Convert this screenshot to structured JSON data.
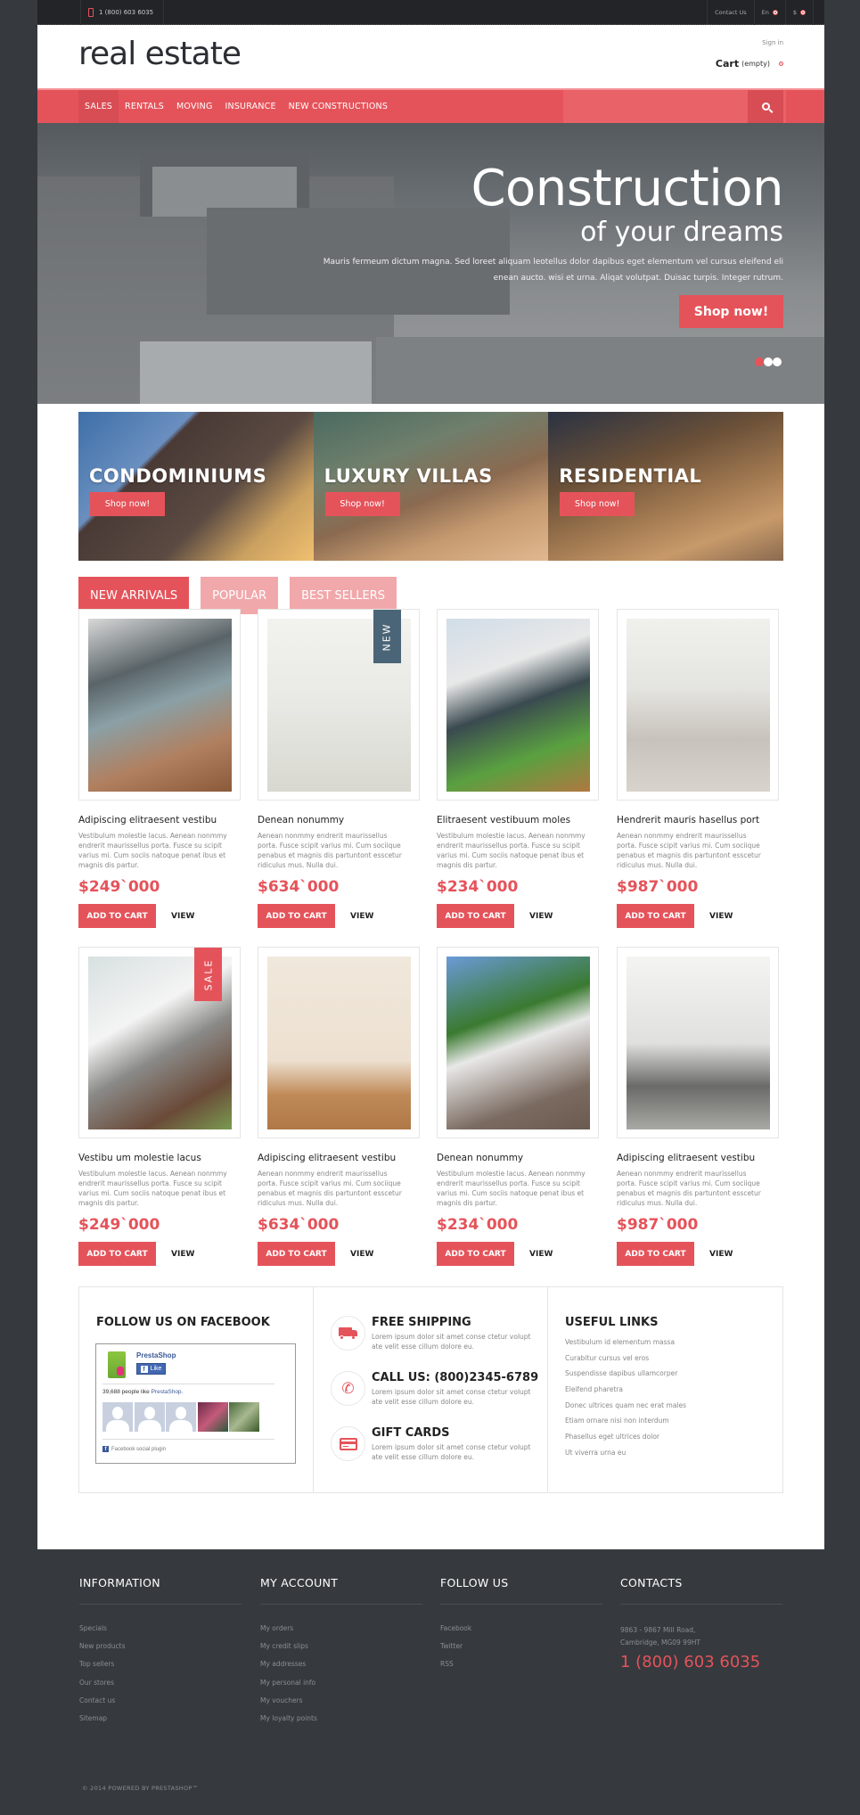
{
  "topbar": {
    "phone": "1 (800) 603 6035",
    "contact_us": "Contact Us",
    "language": "En",
    "currency": "$"
  },
  "header": {
    "logo": "real estate",
    "sign_in": "Sign in",
    "cart_label": "Cart",
    "cart_status": "(empty)"
  },
  "nav": {
    "items": [
      {
        "label": "SALES",
        "active": true
      },
      {
        "label": "RENTALS"
      },
      {
        "label": "MOVING"
      },
      {
        "label": "INSURANCE"
      },
      {
        "label": "NEW CONSTRUCTIONS"
      }
    ]
  },
  "hero": {
    "title": "Construction",
    "subtitle": "of your dreams",
    "text": "Mauris fermeum dictum magna. Sed loreet aliquam leotellus dolor dapibus eget elementum vel cursus eleifend eli enean aucto. wisi et urna. Aliqat volutpat. Duisac turpis. Integer rutrum.",
    "button": "Shop now!",
    "slides": 3,
    "active_slide": 1
  },
  "banners": [
    {
      "title": "CONDOMINIUMS",
      "button": "Shop now!"
    },
    {
      "title": "LUXURY VILLAS",
      "button": "Shop now!"
    },
    {
      "title": "RESIDENTIAL",
      "button": "Shop now!"
    }
  ],
  "tabs": [
    {
      "label": "NEW ARRIVALS",
      "active": true
    },
    {
      "label": "POPULAR"
    },
    {
      "label": "BEST SELLERS"
    }
  ],
  "products": [
    {
      "name": "Adipiscing elitraesent vestibu",
      "desc": "Vestibulum molestie lacus. Aenean nonmmy endrerit maurissellus porta. Fusce su scipit varius mi. Cum sociis natoque penat ibus et magnis dis partur.",
      "price": "$249`000",
      "add": "ADD TO CART",
      "view": "VIEW",
      "flag": ""
    },
    {
      "name": "Denean nonummy",
      "desc": "Aenean nonmmy endrerit maurissellus porta. Fusce scipit varius mi. Cum sociique penabus et magnis dis partuntont esscetur ridiculus mus. Nulla dui.",
      "price": "$634`000",
      "add": "ADD TO CART",
      "view": "VIEW",
      "flag": "NEW"
    },
    {
      "name": "Elitraesent vestibuum moles",
      "desc": "Vestibulum molestie lacus. Aenean nonmmy endrerit maurissellus porta. Fusce su scipit varius mi. Cum sociis natoque penat ibus et magnis dis partur.",
      "price": "$234`000",
      "add": "ADD TO CART",
      "view": "VIEW",
      "flag": ""
    },
    {
      "name": "Hendrerit mauris hasellus port",
      "desc": "Aenean nonmmy endrerit maurissellus porta. Fusce scipit varius mi. Cum sociique penabus et magnis dis partuntont esscetur ridiculus mus. Nulla dui.",
      "price": "$987`000",
      "add": "ADD TO CART",
      "view": "VIEW",
      "flag": ""
    },
    {
      "name": "Vestibu um molestie lacus",
      "desc": "Vestibulum molestie lacus. Aenean nonmmy endrerit maurissellus porta. Fusce su scipit varius mi. Cum sociis natoque penat ibus et magnis dis partur.",
      "price": "$249`000",
      "add": "ADD TO CART",
      "view": "VIEW",
      "flag": "SALE"
    },
    {
      "name": "Adipiscing elitraesent vestibu",
      "desc": "Aenean nonmmy endrerit maurissellus porta. Fusce scipit varius mi. Cum sociique penabus et magnis dis partuntont esscetur ridiculus mus. Nulla dui.",
      "price": "$634`000",
      "add": "ADD TO CART",
      "view": "VIEW",
      "flag": ""
    },
    {
      "name": "Denean nonummy",
      "desc": "Vestibulum molestie lacus. Aenean nonmmy endrerit maurissellus porta. Fusce su scipit varius mi. Cum sociis natoque penat ibus et magnis dis partur.",
      "price": "$234`000",
      "add": "ADD TO CART",
      "view": "VIEW",
      "flag": ""
    },
    {
      "name": "Adipiscing elitraesent vestibu",
      "desc": "Aenean nonmmy endrerit maurissellus porta. Fusce scipit varius mi. Cum sociique penabus et magnis dis partuntont esscetur ridiculus mus. Nulla dui.",
      "price": "$987`000",
      "add": "ADD TO CART",
      "view": "VIEW",
      "flag": ""
    }
  ],
  "facebook": {
    "title": "FOLLOW US ON FACEBOOK",
    "page_name": "PrestaShop",
    "like_button": "Like",
    "count_text": "39,688 people like ",
    "count_page": "PrestaShop.",
    "plugin_label": "Facebook social plugin"
  },
  "features": [
    {
      "icon": "truck-icon",
      "title": "FREE SHIPPING",
      "text": "Lorem ipsum dolor sit amet conse ctetur volupt ate velit esse cillum dolore eu."
    },
    {
      "icon": "phone-icon",
      "title": "CALL US: (800)2345-6789",
      "text": "Lorem ipsum dolor sit amet conse ctetur volupt ate velit esse cillum dolore eu."
    },
    {
      "icon": "credit-card-icon",
      "title": "GIFT CARDS",
      "text": "Lorem ipsum dolor sit amet conse ctetur volupt ate velit esse cillum dolore eu."
    }
  ],
  "useful_links": {
    "title": "USEFUL LINKS",
    "items": [
      "Vestibulum id elementum massa",
      "Curabitur cursus vel eros",
      "Suspendisse dapibus ullamcorper",
      "Eleifend pharetra",
      "Donec ultrices quam nec erat males",
      "Etiam ornare nisi non interdum",
      "Phasellus eget ultrices dolor",
      "Ut viverra urna eu"
    ]
  },
  "footer": {
    "information": {
      "title": "INFORMATION",
      "items": [
        "Specials",
        "New products",
        "Top sellers",
        "Our stores",
        "Contact us",
        "Sitemap"
      ]
    },
    "my_account": {
      "title": "MY ACCOUNT",
      "items": [
        "My orders",
        "My credit slips",
        "My addresses",
        "My personal info",
        "My vouchers",
        "My loyalty points"
      ]
    },
    "follow_us": {
      "title": "FOLLOW US",
      "items": [
        "Facebook",
        "Twitter",
        "RSS"
      ]
    },
    "contacts": {
      "title": "CONTACTS",
      "address_line1": "9863 - 9867 Mill Road,",
      "address_line2": "Cambridge, MG09 99HT",
      "phone": "1 (800) 603 6035"
    },
    "copyright": "© 2014 POWERED BY PRESTASHOP™"
  },
  "colors": {
    "accent": "#e5535a",
    "accent_light": "#f1a8ab",
    "dark_bg": "#363a3e",
    "topbar_bg": "#222427",
    "new_flag": "#4a6577"
  }
}
